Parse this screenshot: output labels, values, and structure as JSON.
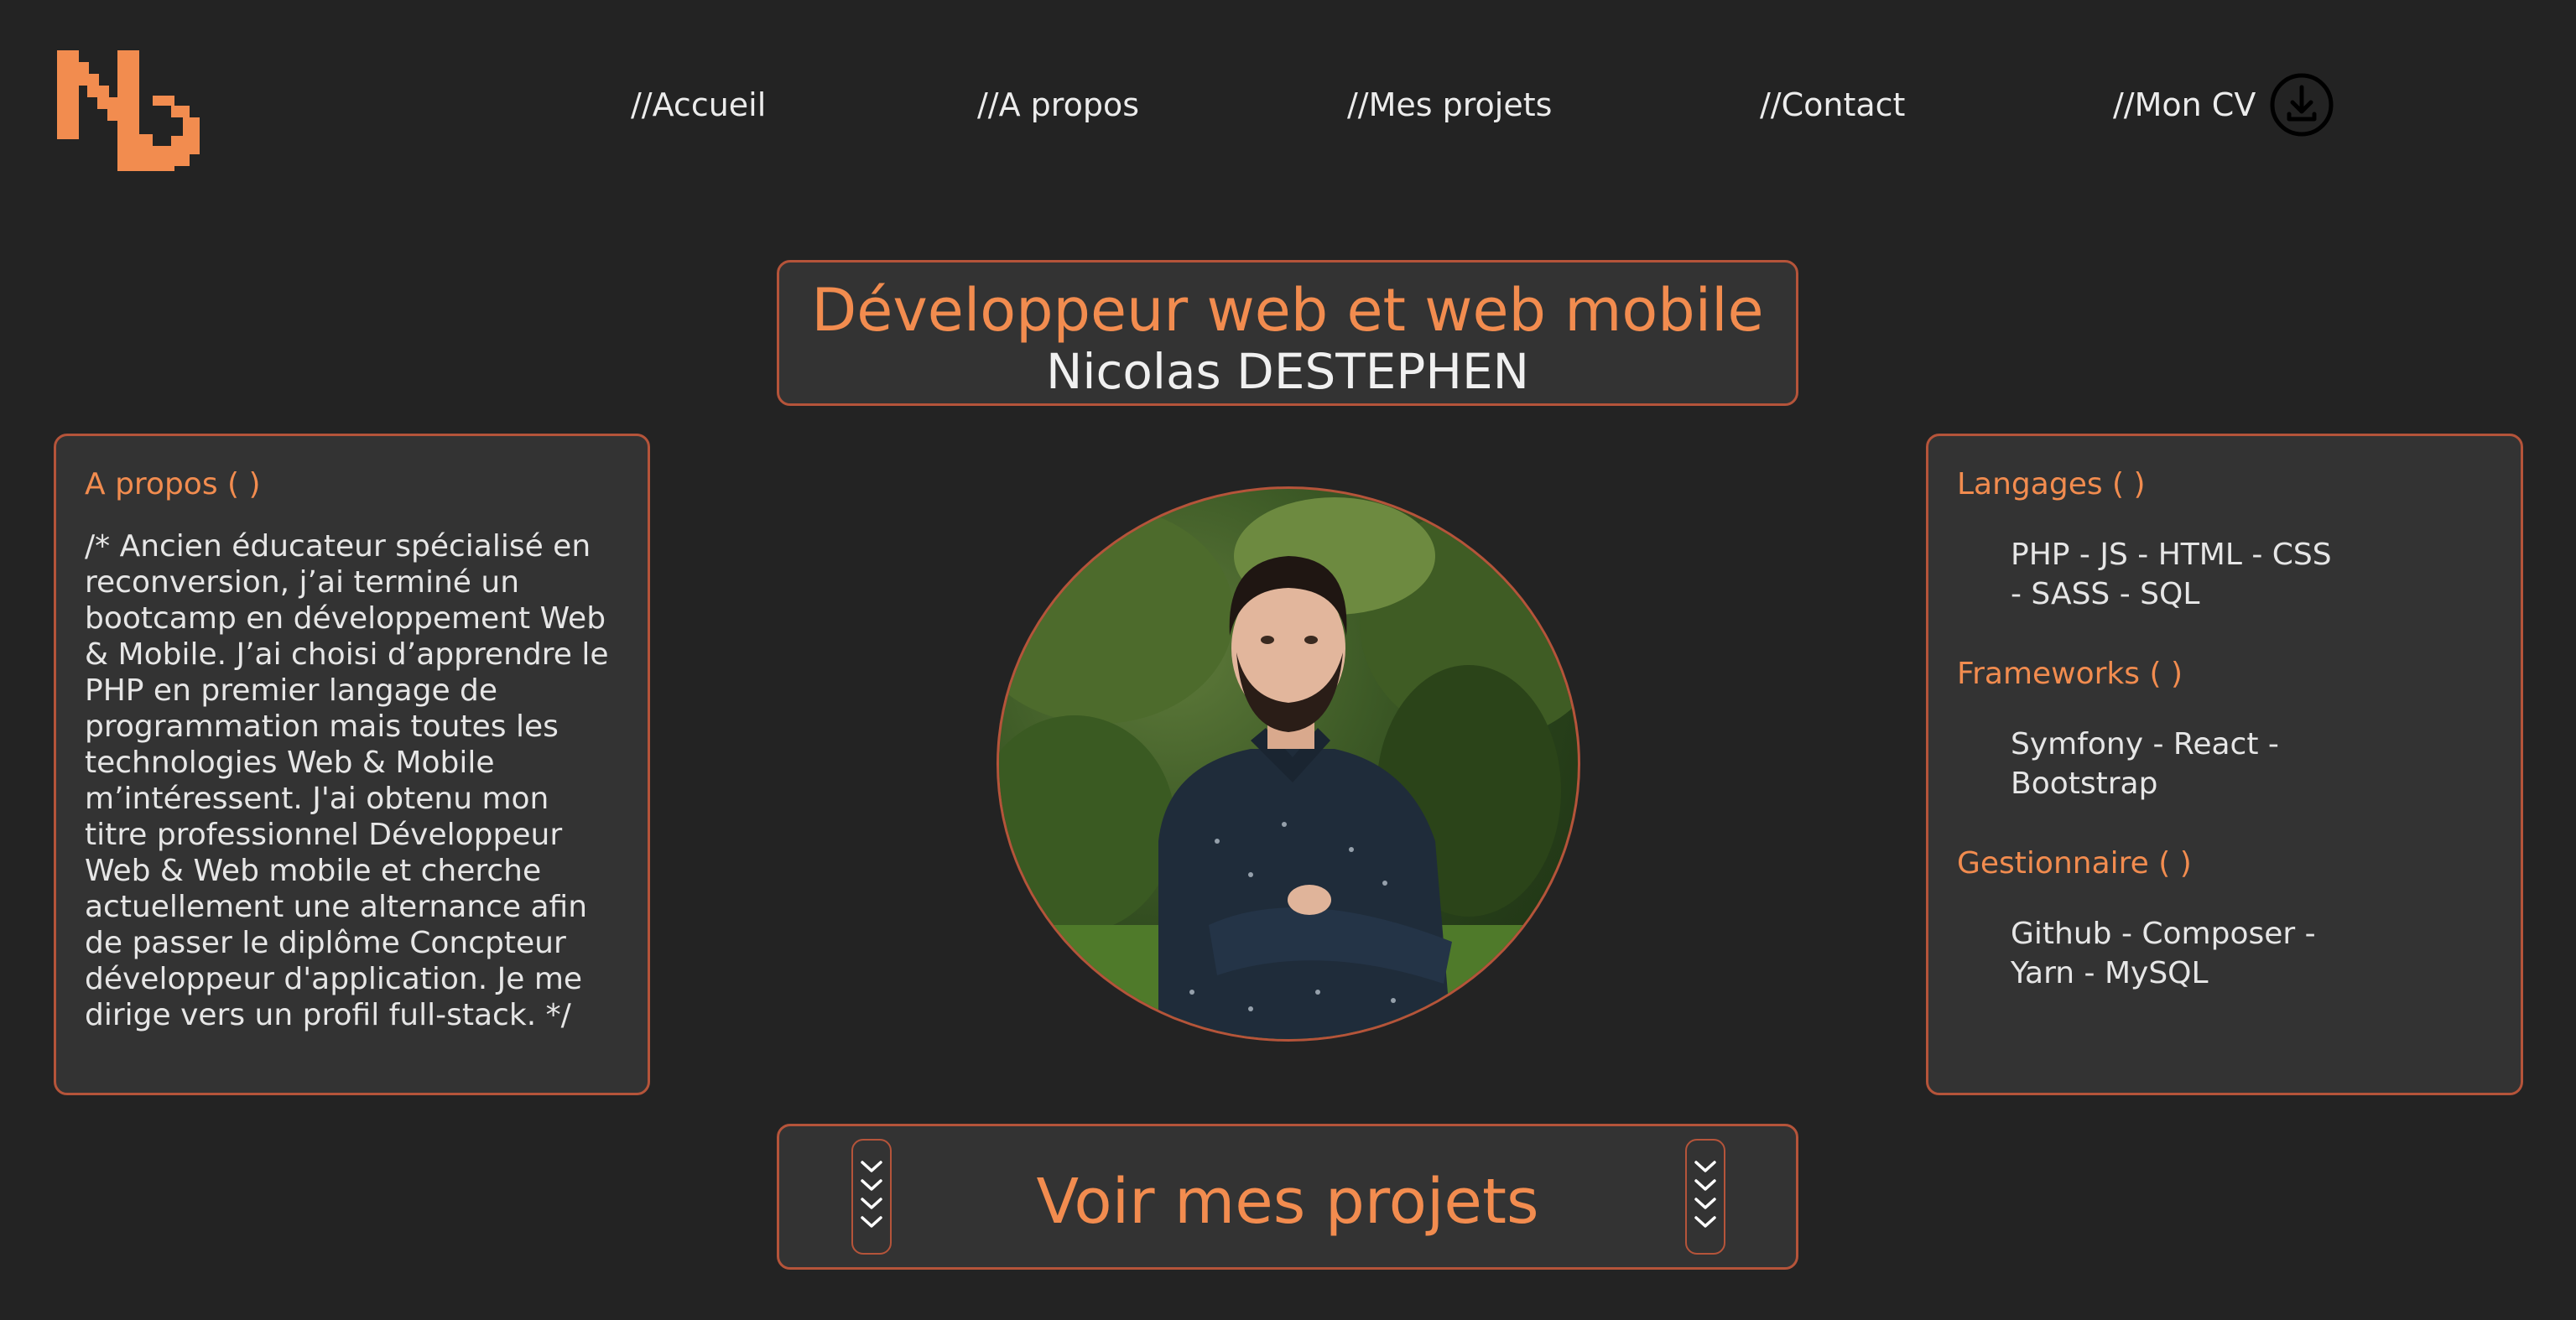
{
  "header": {
    "logo_alt": "ND",
    "nav": [
      {
        "label": "//Accueil"
      },
      {
        "label": "//A propos"
      },
      {
        "label": "//Mes projets"
      },
      {
        "label": "//Contact"
      },
      {
        "label": "//Mon CV"
      }
    ],
    "cv_icon": "download-icon"
  },
  "hero": {
    "title": "Développeur web et web mobile",
    "name": "Nicolas DESTEPHEN"
  },
  "about": {
    "heading": "A propos ( )",
    "text": "/* Ancien éducateur spécialisé en reconversion, j’ai terminé un bootcamp en développement Web & Mobile. J’ai choisi d’apprendre le PHP en premier langage de programmation mais toutes les technologies Web & Mobile m’intéressent. J'ai obtenu mon titre professionnel Développeur Web & Web mobile et cherche actuellement une alternance afin de passer le diplôme Concpteur développeur d'application. Je me dirige vers un profil full-stack. */"
  },
  "skills": [
    {
      "heading": "Langages ( )",
      "items": "PHP - JS - HTML - CSS - SASS - SQL"
    },
    {
      "heading": "Frameworks ( )",
      "items": "Symfony - React - Bootstrap"
    },
    {
      "heading": "Gestionnaire ( )",
      "items": "Github - Composer - Yarn - MySQL"
    }
  ],
  "cta": {
    "label": "Voir mes projets",
    "icon": "chevrons-down-icon"
  },
  "colors": {
    "background": "#232323",
    "panel": "#333333",
    "accent": "#f28c4f",
    "border": "#b5543a",
    "text": "#e6e6e6"
  }
}
